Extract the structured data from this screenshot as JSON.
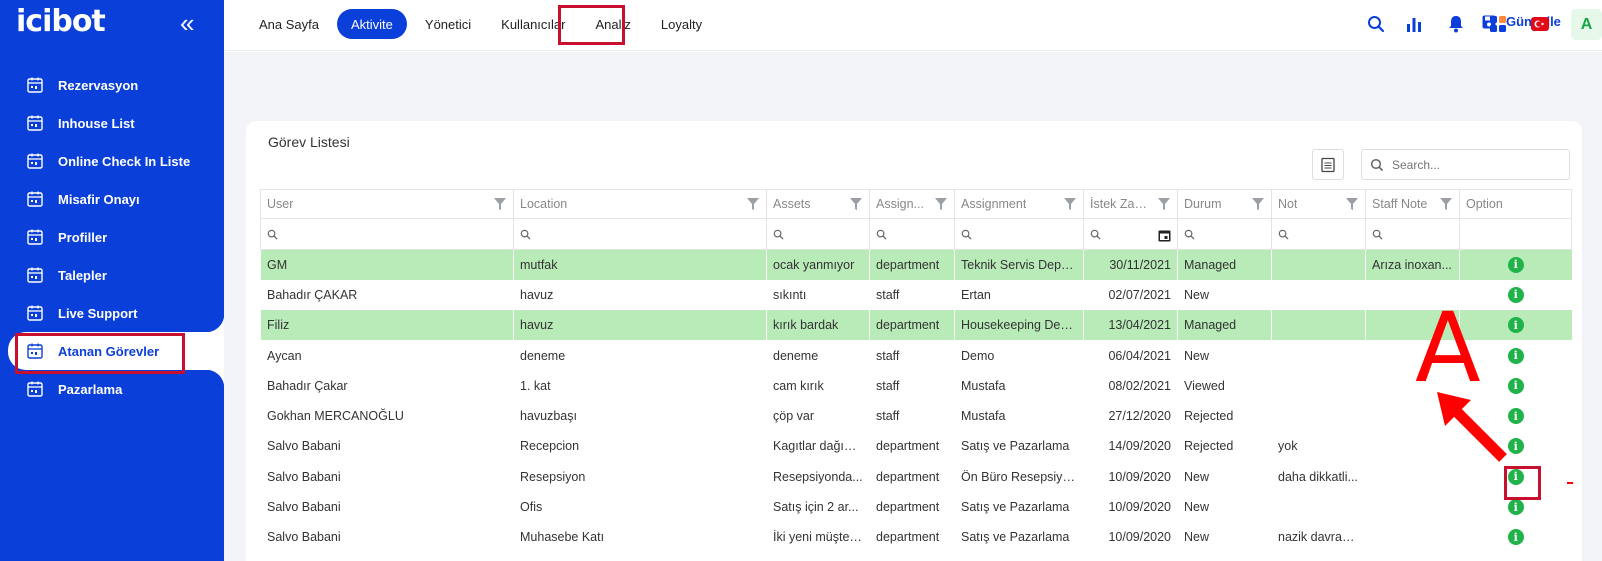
{
  "app": {
    "logo": "icibot"
  },
  "sidebar": {
    "collapse_icon": "double-chevron-left-icon",
    "items": [
      {
        "label": "Rezervasyon",
        "icon": "calendar-icon",
        "active": false
      },
      {
        "label": "Inhouse List",
        "icon": "calendar-icon",
        "active": false
      },
      {
        "label": "Online Check In Liste",
        "icon": "calendar-icon",
        "active": false
      },
      {
        "label": "Misafir Onayı",
        "icon": "calendar-icon",
        "active": false
      },
      {
        "label": "Profiller",
        "icon": "calendar-icon",
        "active": false
      },
      {
        "label": "Talepler",
        "icon": "calendar-icon",
        "active": false
      },
      {
        "label": "Live Support",
        "icon": "calendar-icon",
        "active": false
      },
      {
        "label": "Atanan Görevler",
        "icon": "calendar-icon",
        "active": true
      },
      {
        "label": "Pazarlama",
        "icon": "calendar-icon",
        "active": false
      }
    ]
  },
  "topnav": {
    "items": [
      {
        "label": "Ana Sayfa"
      },
      {
        "label": "Aktivite"
      },
      {
        "label": "Yönetici"
      },
      {
        "label": "Kullanıcılar"
      },
      {
        "label": "Analiz"
      },
      {
        "label": "Loyalty"
      }
    ],
    "guncelle_label": "Güncelle",
    "avatar_letter": "A"
  },
  "colors": {
    "brand": "#0b3fd9",
    "managed_row": "#b8ebb8",
    "info": "#20b34a",
    "annotation": "#c8102e"
  },
  "task_list": {
    "title": "Görev Listesi",
    "search_placeholder": "Search...",
    "columns": [
      "User",
      "Location",
      "Assets",
      "Assign...",
      "Assignment",
      "İstek Zam...",
      "Durum",
      "Not",
      "Staff Note",
      "Option"
    ],
    "rows": [
      {
        "user": "GM",
        "location": "mutfak",
        "assets": "ocak yanmıyor",
        "assign": "department",
        "assignment": "Teknik Servis Departmanı",
        "date": "30/11/2021",
        "status": "Managed",
        "note": "",
        "staff_note": "Arıza inoxan...",
        "highlight": true
      },
      {
        "user": "Bahadır ÇAKAR",
        "location": "havuz",
        "assets": "sıkıntı",
        "assign": "staff",
        "assignment": "Ertan",
        "date": "02/07/2021",
        "status": "New",
        "note": "",
        "staff_note": "",
        "highlight": false
      },
      {
        "user": "Filiz",
        "location": "havuz",
        "assets": "kırık bardak",
        "assign": "department",
        "assignment": "Housekeeping Departmanı",
        "date": "13/04/2021",
        "status": "Managed",
        "note": "",
        "staff_note": "",
        "highlight": true
      },
      {
        "user": "Aycan",
        "location": "deneme",
        "assets": "deneme",
        "assign": "staff",
        "assignment": "Demo",
        "date": "06/04/2021",
        "status": "New",
        "note": "",
        "staff_note": "",
        "highlight": false
      },
      {
        "user": "Bahadır Çakar",
        "location": "1. kat",
        "assets": "cam kırık",
        "assign": "staff",
        "assignment": "Mustafa",
        "date": "08/02/2021",
        "status": "Viewed",
        "note": "",
        "staff_note": "",
        "highlight": false
      },
      {
        "user": "Gokhan MERCANOĞLU",
        "location": "havuzbaşı",
        "assets": "çöp var",
        "assign": "staff",
        "assignment": "Mustafa",
        "date": "27/12/2020",
        "status": "Rejected",
        "note": "",
        "staff_note": "",
        "highlight": false
      },
      {
        "user": "Salvo Babani",
        "location": "Recepcion",
        "assets": "Kagıtlar dağınık.",
        "assign": "department",
        "assignment": "Satış ve Pazarlama",
        "date": "14/09/2020",
        "status": "Rejected",
        "note": "yok",
        "staff_note": "",
        "highlight": false
      },
      {
        "user": "Salvo Babani",
        "location": "Resepsiyon",
        "assets": "Resepsiyonda...",
        "assign": "department",
        "assignment": "Ön Büro Resepsiyon D",
        "date": "10/09/2020",
        "status": "New",
        "note": "daha dikkatli...",
        "staff_note": "",
        "highlight": false
      },
      {
        "user": "Salvo Babani",
        "location": "Ofis",
        "assets": "Satış için 2 ar...",
        "assign": "department",
        "assignment": "Satış ve Pazarlama",
        "date": "10/09/2020",
        "status": "New",
        "note": "",
        "staff_note": "",
        "highlight": false
      },
      {
        "user": "Salvo Babani",
        "location": "Muhasebe Katı",
        "assets": "İki yeni müşter...",
        "assign": "department",
        "assignment": "Satış ve Pazarlama",
        "date": "10/09/2020",
        "status": "New",
        "note": "nazik davranın.",
        "staff_note": "",
        "highlight": false
      }
    ]
  },
  "annotation": {
    "letter": "A"
  }
}
